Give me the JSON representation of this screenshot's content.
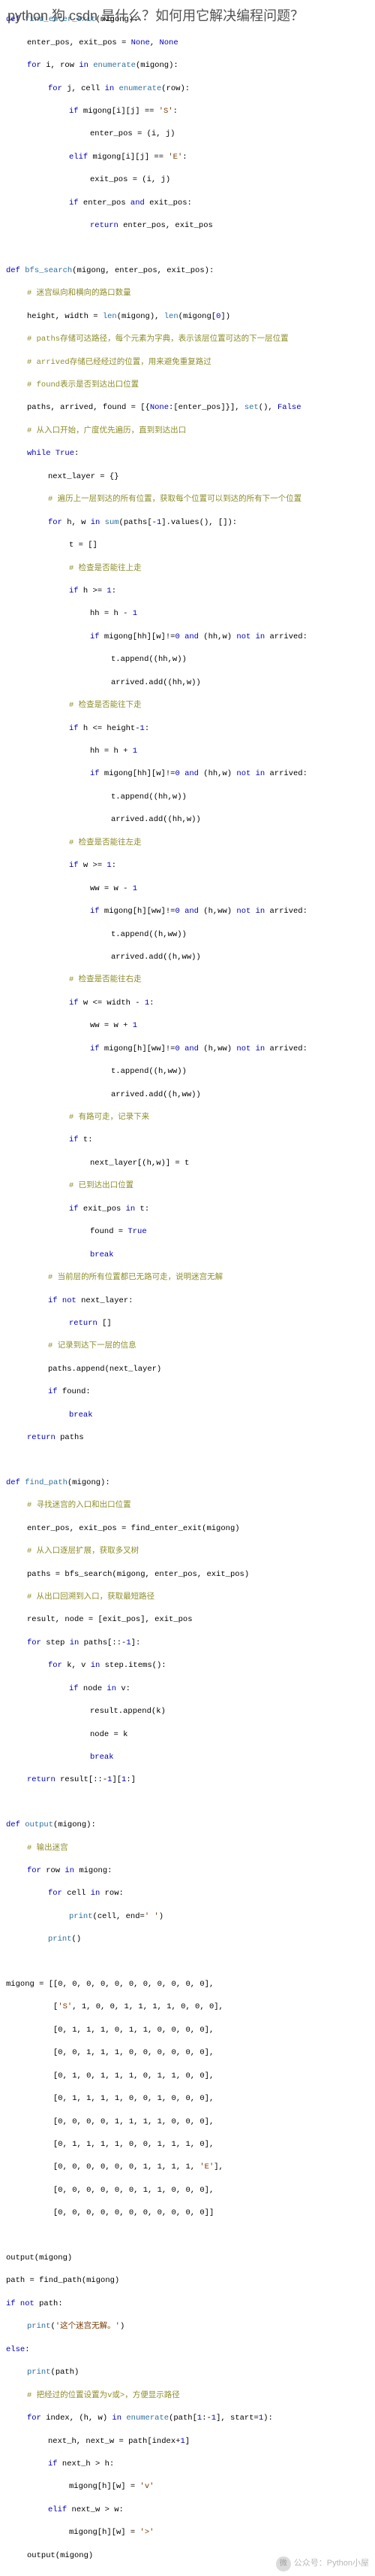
{
  "overlay_title": "python 狗 csdn 是什么？如何用它解决编程问题？",
  "watermark": {
    "icon_label": "微",
    "text": "公众号：Python小屋"
  },
  "code": {
    "fn1": {
      "sig_def": "def ",
      "sig_name": "find_enter_exit",
      "sig_args": "(migong):",
      "l2a": "enter_pos, exit_pos = ",
      "l2b": "None",
      "l2c": ", ",
      "l2d": "None",
      "l3a": "for",
      "l3b": " i, row ",
      "l3c": "in",
      "l3d": " ",
      "l3e": "enumerate",
      "l3f": "(migong):",
      "l4a": "for",
      "l4b": " j, cell ",
      "l4c": "in",
      "l4d": " ",
      "l4e": "enumerate",
      "l4f": "(row):",
      "l5a": "if",
      "l5b": " migong[i][j] == ",
      "l5c": "'S'",
      "l5d": ":",
      "l6": "enter_pos = (i, j)",
      "l7a": "elif",
      "l7b": " migong[i][j] == ",
      "l7c": "'E'",
      "l7d": ":",
      "l8": "exit_pos = (i, j)",
      "l9a": "if",
      "l9b": " enter_pos ",
      "l9c": "and",
      "l9d": " exit_pos:",
      "l10a": "return",
      "l10b": " enter_pos, exit_pos"
    },
    "fn2": {
      "sig_def": "def ",
      "sig_name": "bfs_search",
      "sig_args": "(migong, enter_pos, exit_pos):",
      "c1": "# 迷宫纵向和横向的路口数量",
      "l1a": "height, width = ",
      "l1b": "len",
      "l1c": "(migong), ",
      "l1d": "len",
      "l1e": "(migong[",
      "l1f": "0",
      "l1g": "])",
      "c2": "# paths存储可达路径，每个元素为字典，表示该层位置可达的下一层位置",
      "c3": "# arrived存储已经经过的位置，用来避免重复路过",
      "c4": "# found表示是否到达出口位置",
      "l2a": "paths, arrived, found = [{",
      "l2b": "None",
      "l2c": ":[enter_pos]}], ",
      "l2d": "set",
      "l2e": "(), ",
      "l2f": "False",
      "c5": "# 从入口开始，广度优先遍历，直到到达出口",
      "l3a": "while",
      "l3b": " ",
      "l3c": "True",
      "l3d": ":",
      "l4": "next_layer = {}",
      "c6": "# 遍历上一层到达的所有位置，获取每个位置可以到达的所有下一个位置",
      "l5a": "for",
      "l5b": " h, w ",
      "l5c": "in",
      "l5d": " ",
      "l5e": "sum",
      "l5f": "(paths[-",
      "l5g": "1",
      "l5h": "].values(), []):",
      "l6": "t = []",
      "c7": "# 检查是否能往上走",
      "l7a": "if",
      "l7b": " h >= ",
      "l7c": "1",
      "l7d": ":",
      "l8a": "hh = h - ",
      "l8b": "1",
      "l9a": "if",
      "l9b": " migong[hh][w]!=",
      "l9c": "0",
      "l9d": " ",
      "l9e": "and",
      "l9f": " (hh,w) ",
      "l9g": "not in",
      "l9h": " arrived:",
      "l10": "t.append((hh,w))",
      "l11": "arrived.add((hh,w))",
      "c8": "# 检查是否能往下走",
      "l12a": "if",
      "l12b": " h <= height-",
      "l12c": "1",
      "l12d": ":",
      "l13a": "hh = h + ",
      "l13b": "1",
      "l14a": "if",
      "l14b": " migong[hh][w]!=",
      "l14c": "0",
      "l14d": " ",
      "l14e": "and",
      "l14f": " (hh,w) ",
      "l14g": "not in",
      "l14h": " arrived:",
      "l15": "t.append((hh,w))",
      "l16": "arrived.add((hh,w))",
      "c9": "# 检查是否能往左走",
      "l17a": "if",
      "l17b": " w >= ",
      "l17c": "1",
      "l17d": ":",
      "l18a": "ww = w - ",
      "l18b": "1",
      "l19a": "if",
      "l19b": " migong[h][ww]!=",
      "l19c": "0",
      "l19d": " ",
      "l19e": "and",
      "l19f": " (h,ww) ",
      "l19g": "not in",
      "l19h": " arrived:",
      "l20": "t.append((h,ww))",
      "l21": "arrived.add((h,ww))",
      "c10": "# 检查是否能往右走",
      "l22a": "if",
      "l22b": " w <= width - ",
      "l22c": "1",
      "l22d": ":",
      "l23a": "ww = w + ",
      "l23b": "1",
      "l24a": "if",
      "l24b": " migong[h][ww]!=",
      "l24c": "0",
      "l24d": " ",
      "l24e": "and",
      "l24f": " (h,ww) ",
      "l24g": "not in",
      "l24h": " arrived:",
      "l25": "t.append((h,ww))",
      "l26": "arrived.add((h,ww))",
      "c11": "# 有路可走，记录下来",
      "l27a": "if",
      "l27b": " t:",
      "l28": "next_layer[(h,w)] = t",
      "c12": "# 已到达出口位置",
      "l29a": "if",
      "l29b": " exit_pos ",
      "l29c": "in",
      "l29d": " t:",
      "l30a": "found = ",
      "l30b": "True",
      "l31": "break",
      "c13": "# 当前层的所有位置都已无路可走，说明迷宫无解",
      "l32a": "if",
      "l32b": " ",
      "l32c": "not",
      "l32d": " next_layer:",
      "l33a": "return",
      "l33b": " []",
      "c14": "# 记录到达下一层的信息",
      "l34": "paths.append(next_layer)",
      "l35a": "if",
      "l35b": " found:",
      "l36": "break",
      "l37a": "return",
      "l37b": " paths"
    },
    "fn3": {
      "sig_def": "def ",
      "sig_name": "find_path",
      "sig_args": "(migong):",
      "c1": "# 寻找迷宫的入口和出口位置",
      "l1": "enter_pos, exit_pos = find_enter_exit(migong)",
      "c2": "# 从入口逐层扩展，获取多叉树",
      "l2": "paths = bfs_search(migong, enter_pos, exit_pos)",
      "c3": "# 从出口回溯到入口，获取最短路径",
      "l3": "result, node = [exit_pos], exit_pos",
      "l4a": "for",
      "l4b": " step ",
      "l4c": "in",
      "l4d": " paths[::-",
      "l4e": "1",
      "l4f": "]:",
      "l5a": "for",
      "l5b": " k, v ",
      "l5c": "in",
      "l5d": " step.items():",
      "l6a": "if",
      "l6b": " node ",
      "l6c": "in",
      "l6d": " v:",
      "l7": "result.append(k)",
      "l8": "node = k",
      "l9": "break",
      "l10a": "return",
      "l10b": " result[::-",
      "l10c": "1",
      "l10d": "][",
      "l10e": "1",
      "l10f": ":]"
    },
    "fn4": {
      "sig_def": "def ",
      "sig_name": "output",
      "sig_args": "(migong):",
      "c1": "# 输出迷宫",
      "l1a": "for",
      "l1b": " row ",
      "l1c": "in",
      "l1d": " migong:",
      "l2a": "for",
      "l2b": " cell ",
      "l2c": "in",
      "l2d": " row:",
      "l3a": "print",
      "l3b": "(cell, end=",
      "l3c": "' '",
      "l3d": ")",
      "l4a": "print",
      "l4b": "()"
    },
    "data": {
      "r0": "migong = [[0, 0, 0, 0, 0, 0, 0, 0, 0, 0, 0],",
      "r1a": "          [",
      "r1b": "'S'",
      "r1c": ", 1, 0, 0, 1, 1, 1, 1, 0, 0, 0],",
      "r2": "          [0, 1, 1, 1, 0, 1, 1, 0, 0, 0, 0],",
      "r3": "          [0, 0, 1, 1, 1, 0, 0, 0, 0, 0, 0],",
      "r4": "          [0, 1, 0, 1, 1, 1, 0, 1, 1, 0, 0],",
      "r5": "          [0, 1, 1, 1, 1, 0, 0, 1, 0, 0, 0],",
      "r6": "          [0, 0, 0, 0, 1, 1, 1, 1, 0, 0, 0],",
      "r7": "          [0, 1, 1, 1, 1, 0, 0, 1, 1, 1, 0],",
      "r8a": "          [0, 0, 0, 0, 0, 0, 1, 1, 1, 1, ",
      "r8b": "'E'",
      "r8c": "],",
      "r9": "          [0, 0, 0, 0, 0, 0, 1, 1, 0, 0, 0],",
      "r10": "          [0, 0, 0, 0, 0, 0, 0, 0, 0, 0, 0]]"
    },
    "tail": {
      "l1": "output(migong)",
      "l2": "path = find_path(migong)",
      "l3a": "if",
      "l3b": " ",
      "l3c": "not",
      "l3d": " path:",
      "l4a": "print",
      "l4b": "(",
      "l4c": "'这个迷宫无解。'",
      "l4d": ")",
      "l5a": "else",
      "l5b": ":",
      "l6a": "print",
      "l6b": "(path)",
      "c1": "# 把经过的位置设置为v或>，方便显示路径",
      "l7a": "for",
      "l7b": " index, (h, w) ",
      "l7c": "in",
      "l7d": " ",
      "l7e": "enumerate",
      "l7f": "(path[",
      "l7g": "1",
      "l7h": ":-",
      "l7i": "1",
      "l7j": "], start=",
      "l7k": "1",
      "l7l": "):",
      "l8a": "next_h, next_w = path[index+",
      "l8b": "1",
      "l8c": "]",
      "l9a": "if",
      "l9b": " next_h > h:",
      "l10a": "migong[h][w] = ",
      "l10b": "'v'",
      "l11a": "elif",
      "l11b": " next_w > w:",
      "l12a": "migong[h][w] = ",
      "l12b": "'>'",
      "l13": "output(migong)"
    }
  }
}
